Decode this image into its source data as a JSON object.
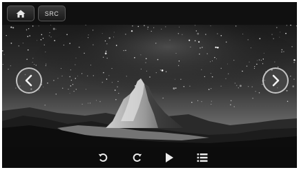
{
  "header": {
    "home_icon": "home-icon",
    "source_label": "SRC"
  },
  "viewer": {
    "prev_icon": "chevron-left-icon",
    "next_icon": "chevron-right-icon",
    "image_subject": "starry-night-mountain-peak"
  },
  "controls": {
    "rotate_left_icon": "rotate-counterclockwise-icon",
    "rotate_right_icon": "rotate-clockwise-icon",
    "play_icon": "play-icon",
    "list_icon": "list-icon"
  },
  "colors": {
    "bar_background": "#101010",
    "icon_color": "#e6e6e6"
  }
}
